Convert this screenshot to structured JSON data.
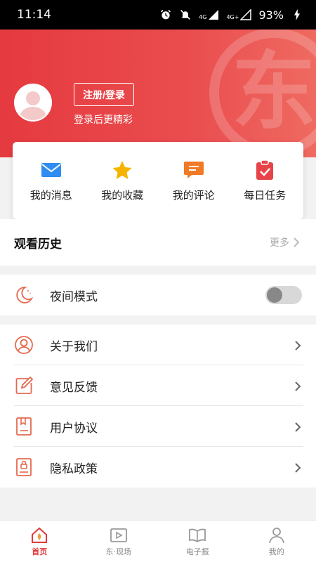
{
  "status_bar": {
    "time": "11:14",
    "battery": "93%",
    "net1": "4G",
    "net2": "4G+"
  },
  "header": {
    "login_button": "注册/登录",
    "login_hint": "登录后更精彩",
    "watermark_char": "东"
  },
  "quick": {
    "items": [
      {
        "label": "我的消息",
        "icon": "mail-icon",
        "color": "#2f8cf0"
      },
      {
        "label": "我的收藏",
        "icon": "star-icon",
        "color": "#f6b300"
      },
      {
        "label": "我的评论",
        "icon": "comment-icon",
        "color": "#f07a26"
      },
      {
        "label": "每日任务",
        "icon": "task-icon",
        "color": "#e8434a"
      }
    ]
  },
  "history": {
    "title": "观看历史",
    "more": "更多"
  },
  "night": {
    "label": "夜间模式",
    "enabled": false
  },
  "menu": {
    "items": [
      {
        "label": "关于我们",
        "icon": "user-circle-icon"
      },
      {
        "label": "意见反馈",
        "icon": "edit-icon"
      },
      {
        "label": "用户协议",
        "icon": "document-icon"
      },
      {
        "label": "隐私政策",
        "icon": "lock-document-icon"
      }
    ]
  },
  "nav": {
    "items": [
      {
        "label": "首页",
        "icon": "home-icon",
        "active": true
      },
      {
        "label": "东·现场",
        "icon": "video-icon",
        "active": false
      },
      {
        "label": "电子报",
        "icon": "book-icon",
        "active": false
      },
      {
        "label": "我的",
        "icon": "person-icon",
        "active": false
      }
    ]
  },
  "colors": {
    "accent": "#e53a3f",
    "icon_outline": "#e5694e"
  }
}
